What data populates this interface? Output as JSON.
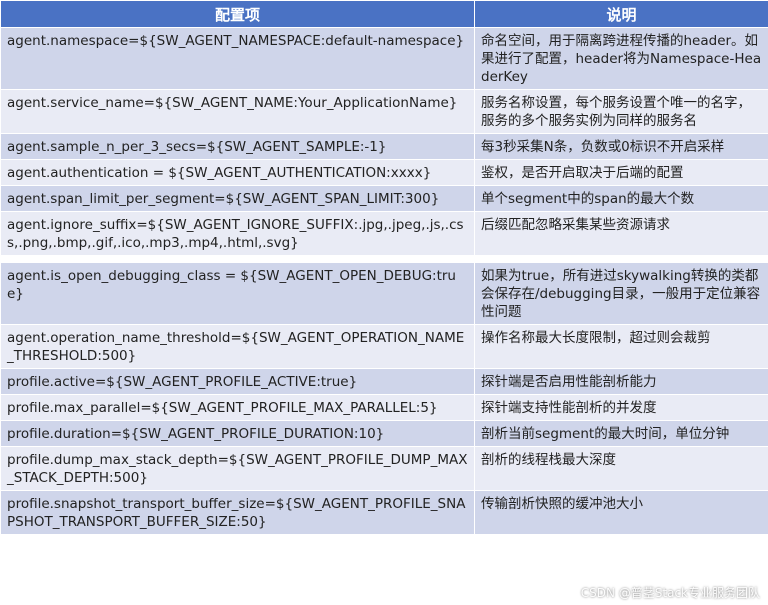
{
  "header": {
    "col1": "配置项",
    "col2": "说明"
  },
  "rows": [
    {
      "key": "agent.namespace=${SW_AGENT_NAMESPACE:default-namespace}",
      "desc": "命名空间，用于隔离跨进程传播的header。如果进行了配置，header将为Namespace-HeaderKey"
    },
    {
      "key": "agent.service_name=${SW_AGENT_NAME:Your_ApplicationName}",
      "desc": "服务名称设置，每个服务设置个唯一的名字，服务的多个服务实例为同样的服务名"
    },
    {
      "key": "agent.sample_n_per_3_secs=${SW_AGENT_SAMPLE:-1}",
      "desc": "每3秒采集N条，负数或0标识不开启采样"
    },
    {
      "key": "agent.authentication = ${SW_AGENT_AUTHENTICATION:xxxx}",
      "desc": "鉴权，是否开启取决于后端的配置"
    },
    {
      "key": "agent.span_limit_per_segment=${SW_AGENT_SPAN_LIMIT:300}",
      "desc": "单个segment中的span的最大个数"
    },
    {
      "key": "agent.ignore_suffix=${SW_AGENT_IGNORE_SUFFIX:.jpg,.jpeg,.js,.css,.png,.bmp,.gif,.ico,.mp3,.mp4,.html,.svg}",
      "desc": "后缀匹配忽略采集某些资源请求"
    },
    {
      "key": "agent.is_open_debugging_class = ${SW_AGENT_OPEN_DEBUG:true}",
      "desc": "如果为true，所有进过skywalking转换的类都会保存在/debugging目录，一般用于定位兼容性问题"
    },
    {
      "key": "agent.operation_name_threshold=${SW_AGENT_OPERATION_NAME_THRESHOLD:500}",
      "desc": "操作名称最大长度限制，超过则会裁剪"
    },
    {
      "key": "profile.active=${SW_AGENT_PROFILE_ACTIVE:true}",
      "desc": "探针端是否启用性能剖析能力"
    },
    {
      "key": "profile.max_parallel=${SW_AGENT_PROFILE_MAX_PARALLEL:5}",
      "desc": "探针端支持性能剖析的并发度"
    },
    {
      "key": "profile.duration=${SW_AGENT_PROFILE_DURATION:10}",
      "desc": "剖析当前segment的最大时间，单位分钟"
    },
    {
      "key": "profile.dump_max_stack_depth=${SW_AGENT_PROFILE_DUMP_MAX_STACK_DEPTH:500}",
      "desc": "剖析的线程栈最大深度"
    },
    {
      "key": "profile.snapshot_transport_buffer_size=${SW_AGENT_PROFILE_SNAPSHOT_TRANSPORT_BUFFER_SIZE:50}",
      "desc": "传输剖析快照的缓冲池大小"
    }
  ],
  "watermark": "CSDN @普茎Stack专业服务团队"
}
